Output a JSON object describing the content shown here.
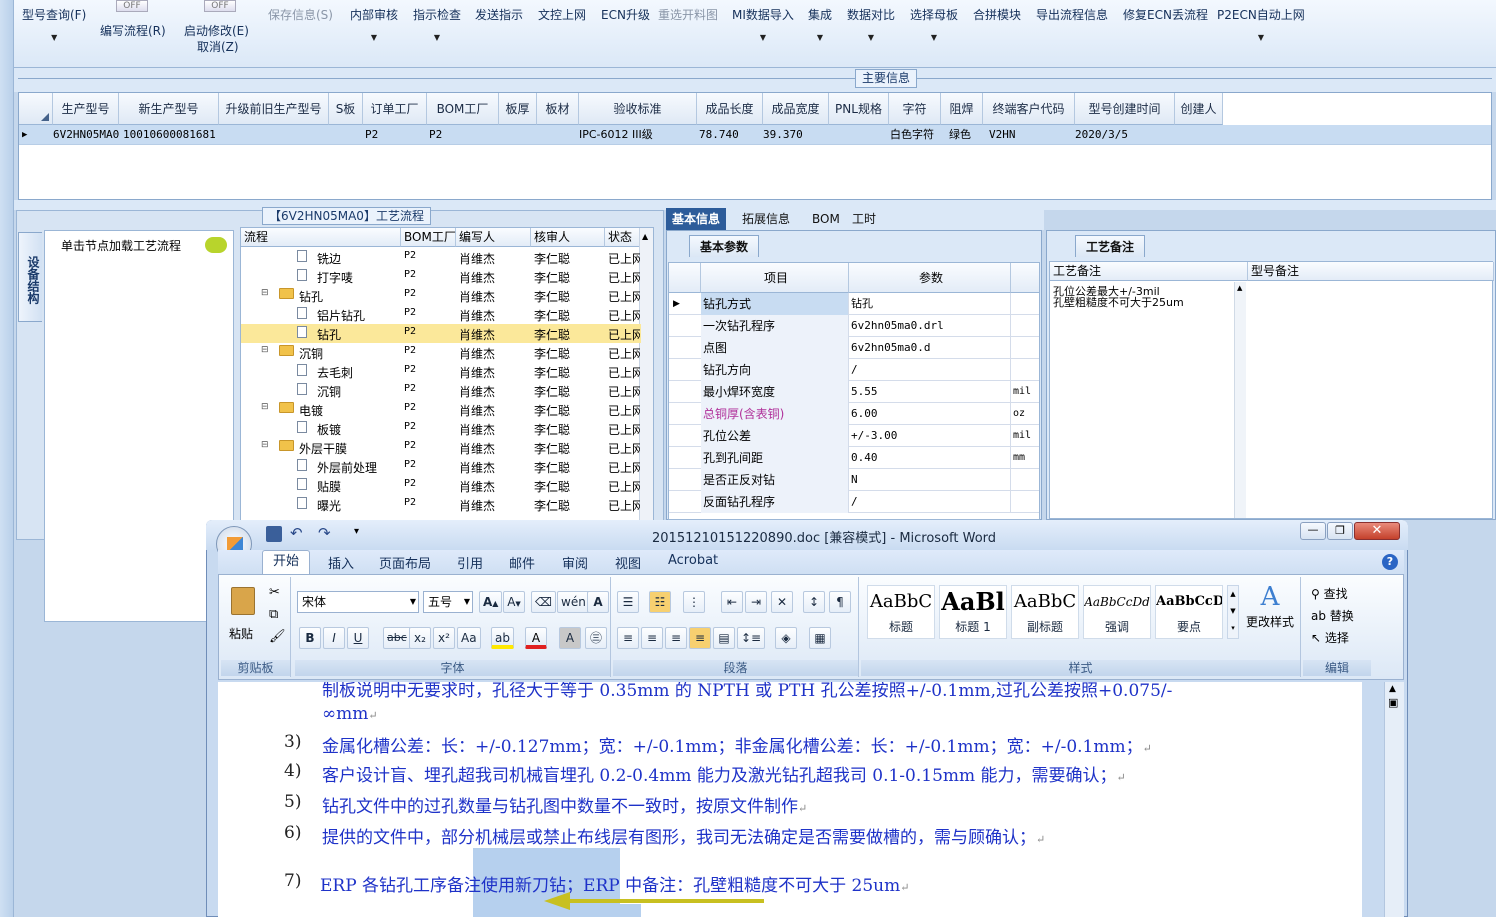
{
  "ribbon": {
    "items": [
      {
        "label": "型号查询(F)",
        "dropdown": true,
        "enabled": true
      },
      {
        "label": "编写流程(R)",
        "switch": "OFF",
        "enabled": true
      },
      {
        "label": "启动修改(E)",
        "sub": "取消(Z)",
        "switch": "OFF",
        "enabled": true
      },
      {
        "label": "保存信息(S)",
        "enabled": false
      },
      {
        "label": "内部审核",
        "dropdown": true,
        "enabled": true
      },
      {
        "label": "指示检查",
        "dropdown": true,
        "enabled": true
      },
      {
        "label": "发送指示",
        "enabled": true
      },
      {
        "label": "文控上网",
        "enabled": true
      },
      {
        "label": "ECN升级",
        "enabled": true
      },
      {
        "label": "重选开料图",
        "enabled": false
      },
      {
        "label": "MI数据导入",
        "dropdown": true,
        "enabled": true
      },
      {
        "label": "集成",
        "dropdown": true,
        "enabled": true
      },
      {
        "label": "数据对比",
        "dropdown": true,
        "enabled": true
      },
      {
        "label": "选择母板",
        "dropdown": true,
        "enabled": true
      },
      {
        "label": "合拼模块",
        "enabled": true
      },
      {
        "label": "导出流程信息",
        "enabled": true
      },
      {
        "label": "修复ECN丢流程",
        "enabled": true
      },
      {
        "label": "P2ECN自动上网",
        "dropdown": true,
        "enabled": true
      }
    ]
  },
  "main_info": {
    "title": "主要信息",
    "columns": [
      "生产型号",
      "新生产型号",
      "升级前旧生产型号",
      "S板",
      "订单工厂",
      "BOM工厂",
      "板厚",
      "板材",
      "验收标准",
      "成品长度",
      "成品宽度",
      "PNL规格",
      "字符",
      "阻焊",
      "终端客户代码",
      "型号创建时间",
      "创建人"
    ],
    "row": [
      "6V2HN05MA0",
      "10010600081681",
      "",
      "",
      "P2",
      "P2",
      "",
      "",
      "IPC-6012 III级",
      "78.740",
      "39.370",
      "",
      "白色字符",
      "绿色",
      "V2HN",
      "2020/3/5",
      ""
    ]
  },
  "left_panel": {
    "vertical_tab": "设备结构",
    "load_hint": "单击节点加载工艺流程"
  },
  "process_tree": {
    "title": "【6V2HN05MA0】工艺流程",
    "columns": [
      "流程",
      "BOM工厂",
      "编写人",
      "核审人",
      "状态"
    ],
    "rows": [
      {
        "name": "铣边",
        "type": "doc",
        "level": 2,
        "bom": "P2",
        "writer": "肖维杰",
        "reviewer": "李仁聪",
        "status": "已上网",
        "selected": false
      },
      {
        "name": "打字唛",
        "type": "doc",
        "level": 2,
        "bom": "P2",
        "writer": "肖维杰",
        "reviewer": "李仁聪",
        "status": "已上网",
        "selected": false
      },
      {
        "name": "钻孔",
        "type": "folder",
        "level": 1,
        "bom": "P2",
        "writer": "肖维杰",
        "reviewer": "李仁聪",
        "status": "已上网",
        "selected": false
      },
      {
        "name": "铝片钻孔",
        "type": "doc",
        "level": 2,
        "bom": "P2",
        "writer": "肖维杰",
        "reviewer": "李仁聪",
        "status": "已上网",
        "selected": false
      },
      {
        "name": "钻孔",
        "type": "doc",
        "level": 2,
        "bom": "P2",
        "writer": "肖维杰",
        "reviewer": "李仁聪",
        "status": "已上网",
        "selected": true
      },
      {
        "name": "沉铜",
        "type": "folder",
        "level": 1,
        "bom": "P2",
        "writer": "肖维杰",
        "reviewer": "李仁聪",
        "status": "已上网",
        "selected": false
      },
      {
        "name": "去毛刺",
        "type": "doc",
        "level": 2,
        "bom": "P2",
        "writer": "肖维杰",
        "reviewer": "李仁聪",
        "status": "已上网",
        "selected": false
      },
      {
        "name": "沉铜",
        "type": "doc",
        "level": 2,
        "bom": "P2",
        "writer": "肖维杰",
        "reviewer": "李仁聪",
        "status": "已上网",
        "selected": false
      },
      {
        "name": "电镀",
        "type": "folder",
        "level": 1,
        "bom": "P2",
        "writer": "肖维杰",
        "reviewer": "李仁聪",
        "status": "已上网",
        "selected": false
      },
      {
        "name": "板镀",
        "type": "doc",
        "level": 2,
        "bom": "P2",
        "writer": "肖维杰",
        "reviewer": "李仁聪",
        "status": "已上网",
        "selected": false
      },
      {
        "name": "外层干膜",
        "type": "folder",
        "level": 1,
        "bom": "P2",
        "writer": "肖维杰",
        "reviewer": "李仁聪",
        "status": "已上网",
        "selected": false
      },
      {
        "name": "外层前处理",
        "type": "doc",
        "level": 2,
        "bom": "P2",
        "writer": "肖维杰",
        "reviewer": "李仁聪",
        "status": "已上网",
        "selected": false
      },
      {
        "name": "贴膜",
        "type": "doc",
        "level": 2,
        "bom": "P2",
        "writer": "肖维杰",
        "reviewer": "李仁聪",
        "status": "已上网",
        "selected": false
      },
      {
        "name": "曝光",
        "type": "doc",
        "level": 2,
        "bom": "P2",
        "writer": "肖维杰",
        "reviewer": "李仁聪",
        "status": "已上网",
        "selected": false
      }
    ]
  },
  "detail": {
    "tabs": [
      "基本信息",
      "拓展信息",
      "BOM",
      "工时"
    ],
    "active_tab": "基本信息",
    "subtab": "基本参数",
    "columns": [
      "项目",
      "参数"
    ],
    "params": [
      {
        "key": "钻孔方式",
        "value": "钻孔",
        "unit": "",
        "highlight": false
      },
      {
        "key": "一次钻孔程序",
        "value": "6v2hn05ma0.drl",
        "unit": "",
        "highlight": false
      },
      {
        "key": "点图",
        "value": "6v2hn05ma0.d",
        "unit": "",
        "highlight": false
      },
      {
        "key": "钻孔方向",
        "value": "/",
        "unit": "",
        "highlight": false
      },
      {
        "key": "最小焊环宽度",
        "value": "5.55",
        "unit": "mil",
        "highlight": false
      },
      {
        "key": "总铜厚(含表铜)",
        "value": "6.00",
        "unit": "oz",
        "highlight": true
      },
      {
        "key": "孔位公差",
        "value": "+/-3.00",
        "unit": "mil",
        "highlight": false
      },
      {
        "key": "孔到孔间距",
        "value": "0.40",
        "unit": "mm",
        "highlight": false
      },
      {
        "key": "是否正反对钻",
        "value": "N",
        "unit": "",
        "highlight": false
      },
      {
        "key": "反面钻孔程序",
        "value": "/",
        "unit": "",
        "highlight": false
      }
    ]
  },
  "notes": {
    "tab": "工艺备注",
    "col1": "工艺备注",
    "col2": "型号备注",
    "line1": "孔位公差最大+/-3mil",
    "line2": "孔壁粗糙度不可大于25um"
  },
  "word": {
    "title": "20151210151220890.doc [兼容模式] - Microsoft Word",
    "tabs": [
      "开始",
      "插入",
      "页面布局",
      "引用",
      "邮件",
      "审阅",
      "视图",
      "Acrobat"
    ],
    "active_tab": "开始",
    "clipboard": {
      "paste": "粘贴",
      "group": "剪贴板"
    },
    "font": {
      "name": "宋体",
      "size": "五号",
      "group": "字体"
    },
    "paragraph": {
      "group": "段落"
    },
    "styles": {
      "group": "样式",
      "items": [
        {
          "preview": "AaBbC",
          "name": "标题"
        },
        {
          "preview": "AaBl",
          "name": "标题 1"
        },
        {
          "preview": "AaBbC",
          "name": "副标题"
        },
        {
          "preview": "AaBbCcDd",
          "name": "强调"
        },
        {
          "preview": "AaBbCcD",
          "name": "要点"
        }
      ],
      "change": "更改样式"
    },
    "editing": {
      "group": "编辑",
      "find": "查找",
      "replace": "替换",
      "select": "选择"
    },
    "doc": {
      "partial_line": "制板说明中无要求时，孔径大于等于 0.35mm 的 NPTH 或 PTH 孔公差按照+/-0.1mm,过孔公差按照+0.075/-",
      "line_cont": "∞mm",
      "items": [
        {
          "num": "3)",
          "text": "金属化槽公差：长：+/-0.127mm；宽：+/-0.1mm；非金属化槽公差：长：+/-0.1mm；宽：+/-0.1mm；"
        },
        {
          "num": "4)",
          "text": "客户设计盲、埋孔超我司机械盲埋孔 0.2-0.4mm 能力及激光钻孔超我司 0.1-0.15mm 能力，需要确认；"
        },
        {
          "num": "5)",
          "text": "钻孔文件中的过孔数量与钻孔图中数量不一致时，按原文件制作"
        },
        {
          "num": "6)",
          "text": "提供的文件中，部分机械层或禁止布线层有图形，我司无法确定是否需要做槽的，需与顾确认；"
        },
        {
          "num": "7)",
          "text": "ERP 各钻孔工序备注使用新刀钻；ERP 中备注：孔壁粗糙度不可大于 25um"
        }
      ]
    }
  },
  "colors": {
    "accent": "#2d5c9a",
    "doc_text": "#1e32c8",
    "selection": "#fbe89a",
    "arrow": "#c8c020"
  }
}
